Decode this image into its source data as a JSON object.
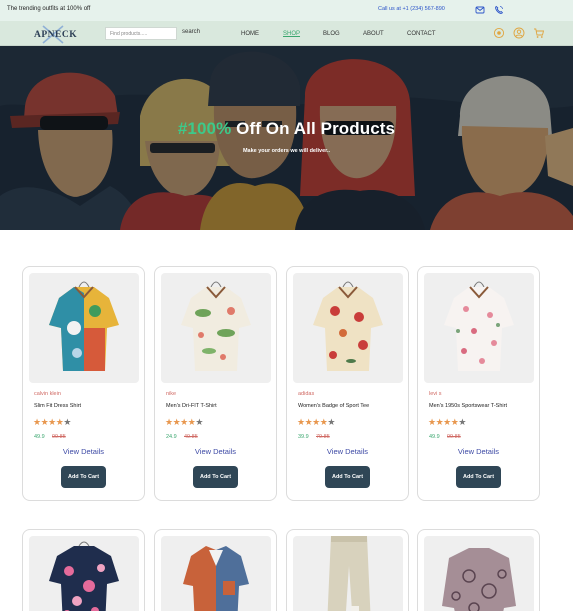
{
  "topbar": {
    "promo": "The trending outfits at 100% off",
    "call": "Call us at +1 (234) 567-890",
    "mail_icon": "mail-icon",
    "phone_icon": "phone-icon"
  },
  "navbar": {
    "logo": "APNECK",
    "search_placeholder": "Find products.....",
    "search_label": "search",
    "links": [
      "HOME",
      "SHOP",
      "BLOG",
      "ABOUT",
      "CONTACT"
    ],
    "active_link": "SHOP",
    "icons": [
      "eye-icon",
      "user-icon",
      "cart-icon"
    ]
  },
  "hero": {
    "title_accent": "#100%",
    "title_rest": " Off On All Products",
    "subtitle": "Make your orders we will deliver.."
  },
  "colors": {
    "accent_green": "#3dc98a",
    "price_green": "#3aa66e",
    "brand_red": "#d06a64",
    "star_orange": "#e8974e",
    "button_dark": "#2f4656",
    "link_blue": "#3d4aa5"
  },
  "products": [
    {
      "brand": "calvin klein",
      "name": "Slim Fit Dress Shirt",
      "rating": 4,
      "price": "49.9",
      "old_price": "99.85",
      "details": "View Details",
      "cart": "Add To Cart"
    },
    {
      "brand": "nike",
      "name": "Men's Dri-FIT T-Shirt",
      "rating": 4,
      "price": "24.9",
      "old_price": "49.85",
      "details": "View Details",
      "cart": "Add To Cart"
    },
    {
      "brand": "adidas",
      "name": "Women's Badge of Sport Tee",
      "rating": 4,
      "price": "39.9",
      "old_price": "79.85",
      "details": "View Details",
      "cart": "Add To Cart"
    },
    {
      "brand": "levi s",
      "name": "Men's 1950s Sportswear T-Shirt",
      "rating": 4,
      "price": "49.9",
      "old_price": "99.85",
      "details": "View Details",
      "cart": "Add To Cart"
    }
  ]
}
